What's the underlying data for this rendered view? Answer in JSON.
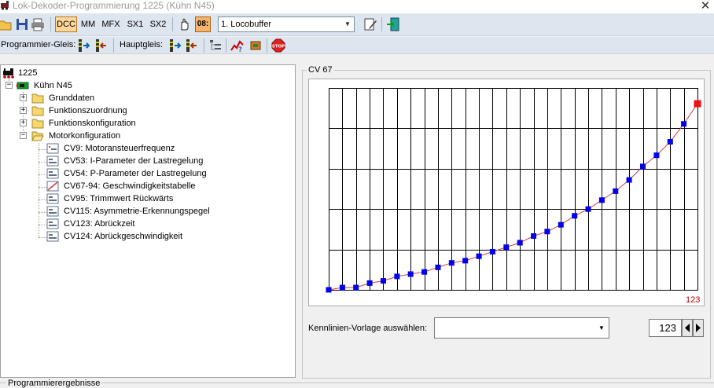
{
  "window": {
    "title": "Lok-Dekoder-Programmierung 1225 (Kühn N45)",
    "close_glyph": "✕"
  },
  "toolbar1": {
    "protocols": [
      "DCC",
      "MM",
      "MFX",
      "SX1",
      "SX2"
    ],
    "active_protocol": "DCC",
    "hex_button": "08:",
    "interface_value": "1. Locobuffer"
  },
  "toolbar2": {
    "prog_track_label": "Programmier-Gleis:",
    "main_track_label": "Hauptgleis:",
    "stop_label": "STOP"
  },
  "tree": {
    "root": "1225",
    "decoder": "Kühn N45",
    "folders": [
      "Grunddaten",
      "Funktionszuordnung",
      "Funktionskonfiguration",
      "Motorkonfiguration"
    ],
    "motor_items": [
      "CV9: Motoransteuerfrequenz",
      "CV53: I-Parameter der Lastregelung",
      "CV54: P-Parameter der Lastregelung",
      "CV67-94: Geschwindigkeitstabelle",
      "CV95: Trimmwert Rückwärts",
      "CV115: Asymmetrie-Erkennungspegel",
      "CV123: Abrückzeit",
      "CV124: Abrückgeschwindigkeit"
    ]
  },
  "panel": {
    "group_title": "CV 67",
    "selected_value_label": "123",
    "preset_label": "Kennlinien-Vorlage auswählen:",
    "preset_value": "",
    "spin_value": "123"
  },
  "colors": {
    "toolbar_bg": "#dde5ef",
    "curve_line": "#d04040",
    "point": "#0000ee",
    "selected_point": "#ee1111",
    "active_protocol_bg": "#ffd79a"
  },
  "chart_data": {
    "type": "line",
    "x": [
      1,
      2,
      3,
      4,
      5,
      6,
      7,
      8,
      9,
      10,
      11,
      12,
      13,
      14,
      15,
      16,
      17,
      18,
      19,
      20,
      21,
      22,
      23,
      24,
      25,
      26,
      27,
      28
    ],
    "values": [
      0,
      1,
      1,
      3,
      4,
      6,
      7,
      8,
      10,
      12,
      13,
      15,
      17,
      19,
      21,
      24,
      26,
      29,
      33,
      36,
      40,
      44,
      49,
      55,
      60,
      66,
      74,
      83
    ],
    "selected_index": 27,
    "ylim": [
      0,
      90
    ],
    "grid": true
  },
  "bottom": {
    "results_label": "Programmierergebnisse"
  }
}
